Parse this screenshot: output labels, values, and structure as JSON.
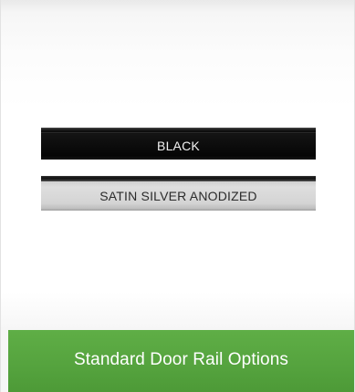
{
  "rails": [
    {
      "label": "BLACK",
      "color": "#0a0a0a"
    },
    {
      "label": "SATIN SILVER ANODIZED",
      "color": "#d6d6d6"
    }
  ],
  "footer": {
    "title": "Standard Door Rail Options",
    "color": "#55a33e"
  }
}
